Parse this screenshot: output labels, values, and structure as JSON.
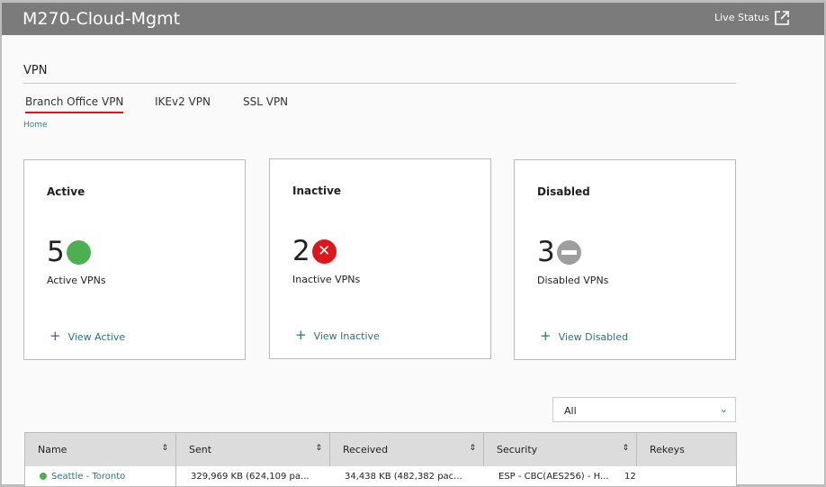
{
  "header": {
    "title": "M270-Cloud-Mgmt",
    "live_status": "Live Status"
  },
  "section": "VPN",
  "tabs": [
    {
      "label": "Branch Office VPN",
      "active": true
    },
    {
      "label": "IKEv2 VPN"
    },
    {
      "label": "SSL VPN"
    }
  ],
  "breadcrumb": "Home",
  "cards": [
    {
      "title": "Active",
      "count": "5",
      "icon": "green-circle-icon",
      "color": "#4caf50",
      "subtitle": "Active VPNs",
      "link": "View Active"
    },
    {
      "title": "Inactive",
      "count": "2",
      "icon": "red-x-circle-icon",
      "color": "#e0161b",
      "subtitle": "Inactive VPNs",
      "link": "View Inactive"
    },
    {
      "title": "Disabled",
      "count": "3",
      "icon": "gray-minus-circle-icon",
      "color": "#9e9e9e",
      "subtitle": "Disabled VPNs",
      "link": "View Disabled"
    }
  ],
  "filter": {
    "value": "All"
  },
  "table": {
    "columns": [
      "Name",
      "Sent",
      "Received",
      "Security",
      "Rekeys"
    ],
    "rows": [
      {
        "name": "Seattle - Toronto",
        "status_color": "#4caf50",
        "sent": "329,969 KB (624,109 pa...",
        "received": "34,438 KB (482,382 pac...",
        "security": "ESP - CBC(AES256) - H...",
        "rekeys": "12"
      }
    ]
  }
}
